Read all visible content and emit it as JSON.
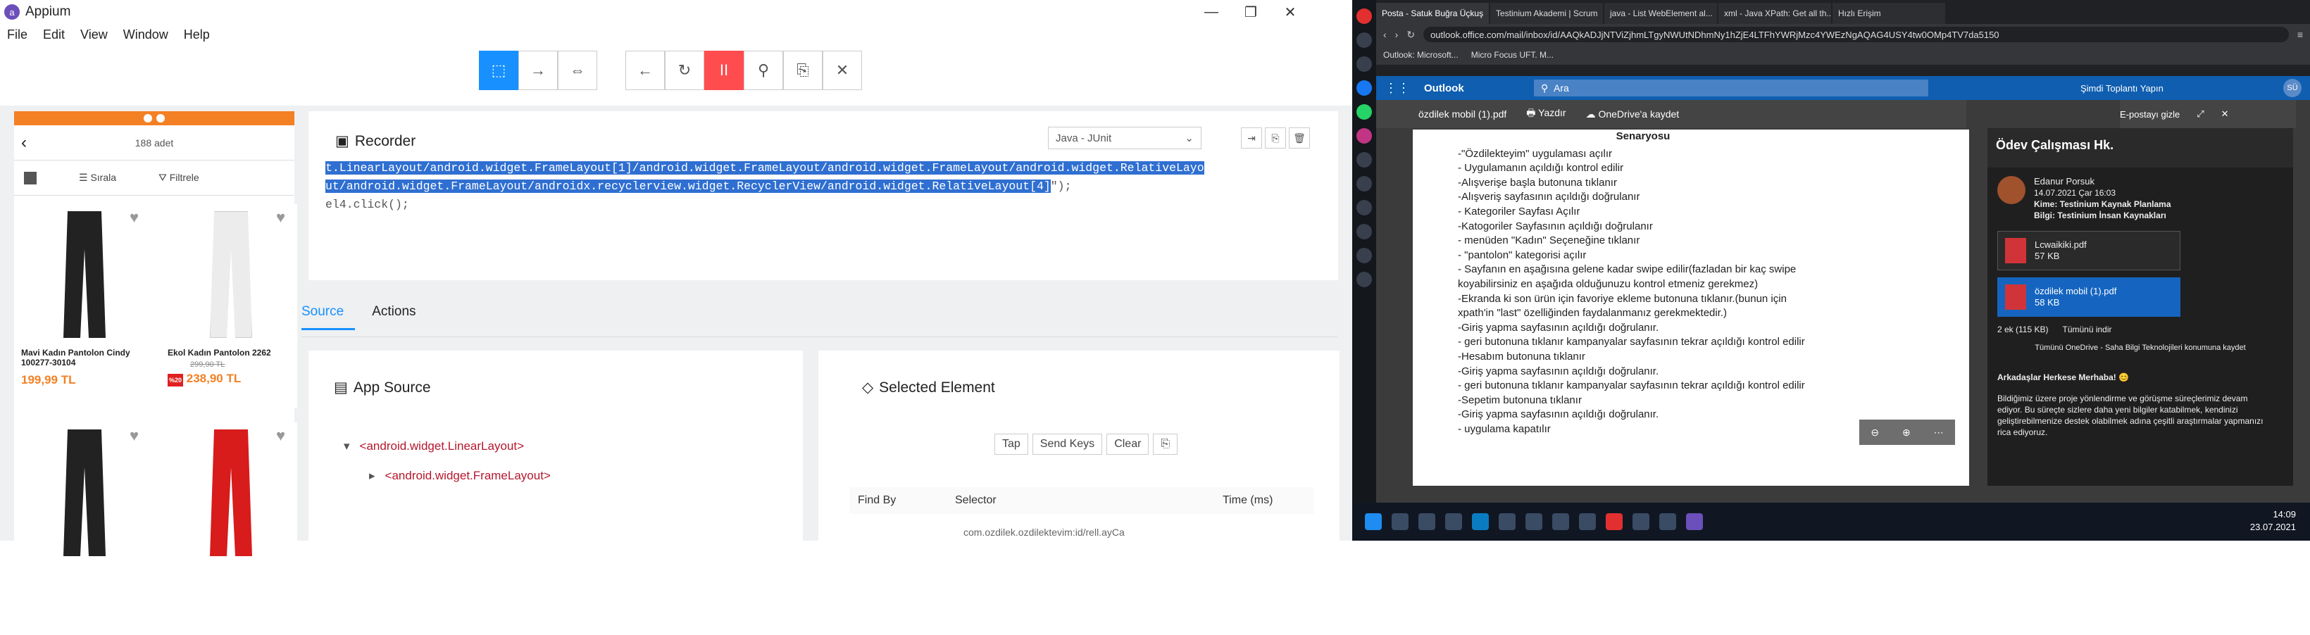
{
  "appium": {
    "title": "Appium",
    "menu": [
      "File",
      "Edit",
      "View",
      "Window",
      "Help"
    ],
    "window_controls": [
      "—",
      "❐",
      "✕"
    ],
    "toolbar": [
      "⬚",
      "→",
      "⇔",
      "←",
      "↻",
      "II",
      "⚲",
      "⎘",
      "✕"
    ]
  },
  "phone": {
    "count": "188 adet",
    "sort": "Sırala",
    "filter": "Filtrele",
    "products": [
      {
        "name": "Mavi Kadın Pantolon Cindy 100277-30104",
        "price": "199,99 TL",
        "old": "",
        "badge": ""
      },
      {
        "name": "Ekol Kadın Pantolon 2262",
        "price": "238,90 TL",
        "old": "299,90 TL",
        "badge": "%20"
      },
      {
        "name": "",
        "price": "",
        "old": "",
        "badge": ""
      },
      {
        "name": "",
        "price": "",
        "old": "",
        "badge": ""
      }
    ]
  },
  "recorder": {
    "title": "Recorder",
    "language": "Java - JUnit",
    "code_line1": "t.LinearLayout/android.widget.FrameLayout[1]/android.widget.FrameLayout/android.widget.FrameLayout/android.widget.RelativeLayo",
    "code_line2": "ut/android.widget.FrameLayout/androidx.recyclerview.widget.RecyclerView/android.widget.RelativeLayout[4]",
    "code_line2_rest": "\");",
    "code_line3": "el4.click();"
  },
  "tabs": [
    "Source",
    "Actions"
  ],
  "app_source": {
    "title": "App Source",
    "nodes": [
      "<android.widget.LinearLayout>",
      "<android.widget.FrameLayout>"
    ]
  },
  "selected": {
    "title": "Selected Element",
    "buttons": [
      "Tap",
      "Send Keys",
      "Clear"
    ],
    "cols": [
      "Find By",
      "Selector",
      "Time (ms)"
    ],
    "selector_val": "com.ozdilek.ozdilektevim:id/rell.ayCa"
  },
  "browser": {
    "tabs": [
      "Posta - Satuk Buğra Üçkuş",
      "Testinium Akademi | Scrum",
      "java - List WebElement al...",
      "xml - Java XPath: Get all th...",
      "Hızlı Erişim"
    ],
    "address": "outlook.office.com/mail/inbox/id/AAQkADJjNTViZjhmLTgyNWUtNDhmNy1hZjE4LTFhYWRjMzc4YWEzNgAQAG4USY4tw0OMp4TV7da5150",
    "bookmarks": [
      "Outlook: Microsoft...",
      "Micro Focus UFT. M..."
    ]
  },
  "outlook": {
    "brand": "Outlook",
    "search": "Ara",
    "meet": "Şimdi Toplantı Yapın",
    "user": "SÜ"
  },
  "pdf": {
    "filename": "özdilek mobil (1).pdf",
    "print": "Yazdır",
    "save": "OneDrive'a kaydet",
    "hide": "E-postayı gizle",
    "heading": "Senaryosu",
    "lines": [
      "-\"Özdilekteyim\" uygulaması açılır",
      "- Uygulamanın açıldığı kontrol edilir",
      "-Alışverişe başla butonuna tıklanır",
      "-Alışveriş sayfasının açıldığı doğrulanır",
      "- Kategoriler Sayfası Açılır",
      "-Katogoriler Sayfasının açıldığı doğrulanır",
      "- menüden \"Kadın\" Seçeneğine tıklanır",
      "- \"pantolon\" kategorisi açılır",
      "- Sayfanın en aşağısına gelene kadar swipe edilir(fazladan bir kaç swipe",
      "koyabilirsiniz en aşağıda olduğunuzu kontrol etmeniz gerekmez)",
      "-Ekranda ki son ürün için favoriye ekleme butonuna tıklanır.(bunun için",
      "xpath'in \"last\" özelliğinden faydalanmanız gerekmektedir.)",
      "-Giriş yapma sayfasının açıldığı doğrulanır.",
      "- geri butonuna tıklanır kampanyalar sayfasının tekrar açıldığı kontrol edilir",
      "-Hesabım butonuna tıklanır",
      "-Giriş yapma sayfasının açıldığı doğrulanır.",
      "- geri butonuna tıklanır kampanyalar sayfasının tekrar açıldığı kontrol edilir",
      "-Sepetim butonuna tıklanır",
      "-Giriş yapma sayfasının açıldığı doğrulanır.",
      "- uygulama kapatılır"
    ]
  },
  "mail": {
    "subject": "Ödev Çalışması Hk.",
    "sender": "Edanur Porsuk",
    "date": "14.07.2021 Çar 16:03",
    "to": "Kime: Testinium Kaynak Planlama",
    "cc": "Bilgi: Testinium İnsan Kaynakları",
    "attachments": [
      {
        "name": "Lcwaikiki.pdf",
        "size": "57 KB"
      },
      {
        "name": "özdilek mobil (1).pdf",
        "size": "58 KB"
      }
    ],
    "att_summary": "2 ek (115 KB)",
    "download_all": "Tümünü indir",
    "onedrive_note": "Tümünü OneDrive - Saha Bilgi Teknolojileri konumuna kaydet",
    "greeting": "Arkadaşlar Herkese Merhaba! 😊",
    "body": "Bildiğimiz üzere proje yönlendirme ve görüşme süreçlerimiz devam ediyor. Bu süreçte sizlere daha yeni bilgiler katabilmek, kendinizi geliştirebilmenize destek olabilmek adına çeşitli araştırmalar yapmanızı rica ediyoruz."
  },
  "taskbar": {
    "time": "14:09",
    "date": "23.07.2021"
  }
}
